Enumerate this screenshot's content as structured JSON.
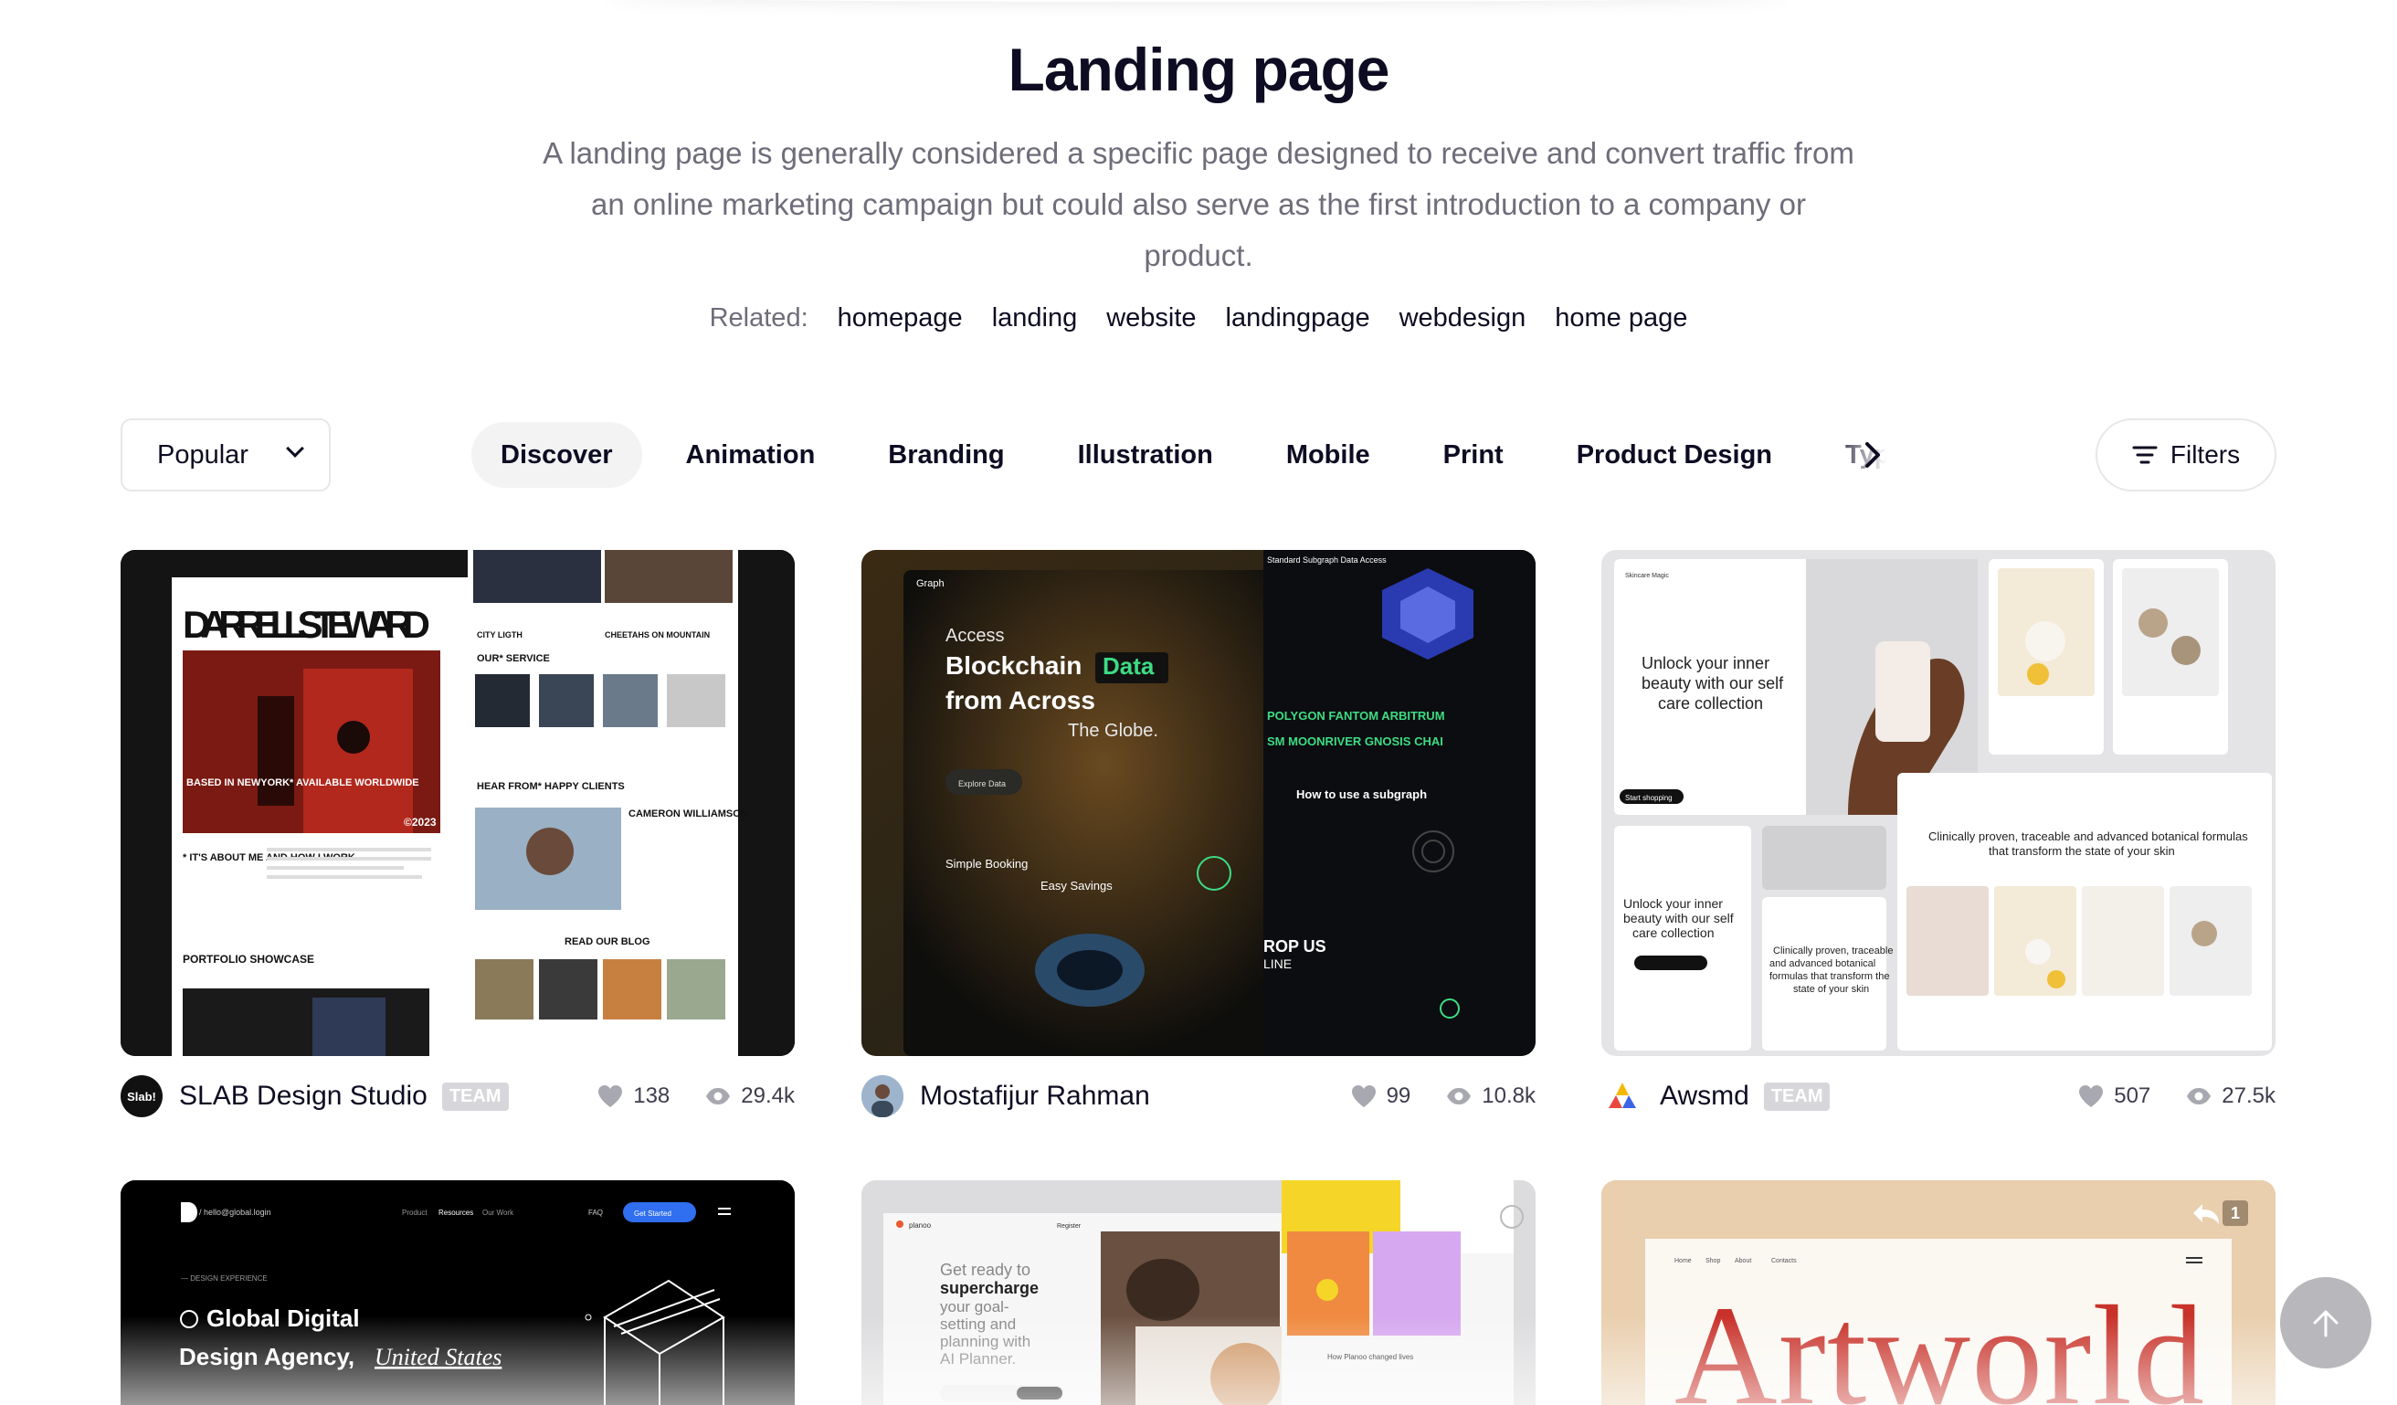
{
  "header": {
    "title": "Landing page",
    "description": "A landing page is generally considered a specific page designed to receive and convert traffic from an online marketing campaign but could also serve as the first introduction to a company or product.",
    "related_label": "Related:",
    "related": [
      "homepage",
      "landing",
      "website",
      "landingpage",
      "webdesign",
      "home page"
    ]
  },
  "toolbar": {
    "sort_value": "Popular",
    "categories": [
      "Discover",
      "Animation",
      "Branding",
      "Illustration",
      "Mobile",
      "Print",
      "Product Design",
      "Typo"
    ],
    "active_category": "Discover",
    "filters_label": "Filters"
  },
  "shots": [
    {
      "author": "SLAB Design Studio",
      "avatar_text": "Slab!",
      "badge": "TEAM",
      "likes": "138",
      "views": "29.4k",
      "thumb": {
        "headline": "DARRELL STEWARD",
        "year": "©2023",
        "tagline": "BASED IN NEWYORK* AVAILABLE WORLDWIDE",
        "about": "* IT'S ABOUT ME AND HOW I WORK",
        "portfolio": "PORTFOLIO SHOWCASE",
        "city": "CITY LIGTH",
        "service": "OUR* SERVICE",
        "hear": "HEAR FROM* HAPPY CLIENTS",
        "person": "CAMERON WILLIAMSON",
        "blog": "READ OUR BLOG",
        "cheetahs": "CHEETAHS ON MOUNTAIN"
      }
    },
    {
      "author": "Mostafijur Rahman",
      "badge": "",
      "likes": "99",
      "views": "10.8k",
      "thumb": {
        "brand": "Graph",
        "access": "Access",
        "line1": "Blockchain",
        "highlight": "Data",
        "line2": "from Across",
        "line3": "The Globe.",
        "cta": "Explore Data",
        "simple": "Simple Booking",
        "easy": "Easy Savings",
        "howto": "How to use a subgraph",
        "standard": "Standard Subgraph Data Access",
        "marquee1": "POLYGON  FANTOM  ARBITRUM",
        "marquee2": "SM  MOONRIVER  GNOSIS CHAI",
        "drop": "ROP US",
        "line": "LINE"
      }
    },
    {
      "author": "Awsmd",
      "badge": "TEAM",
      "likes": "507",
      "views": "27.5k",
      "thumb": {
        "hero": "Unlock your inner beauty with our self care collection",
        "hero_small": "Unlock your inner beauty with our self care collection",
        "clinical": "Clinically proven, traceable and advanced botanical formulas that transform the state of your skin",
        "clinical_small": "Clinically proven, traceable and advanced botanical formulas that transform the state of your skin",
        "cta": "Start shopping",
        "brand": "Skincare Magic"
      }
    }
  ],
  "shots_row2": [
    {
      "email": "/ hello@global.login",
      "nav": [
        "Product",
        "Resources",
        "Our Work"
      ],
      "faq": "FAQ",
      "cta": "Get Started",
      "kicker": "— DESIGN EXPERIENCE",
      "line1": "Global Digital",
      "line2": "Design Agency,",
      "location": "United States"
    },
    {
      "brand": "planoo",
      "heading_light": "Get ready to",
      "heading_bold": "supercharge",
      "heading_rest": "your goal- setting and planning with AI Planner.",
      "changed": "How Planoo changed lives",
      "register": "Register"
    },
    {
      "nav": [
        "Home",
        "Shop",
        "About",
        "Contacts"
      ],
      "headline": "Artworld",
      "count": "1"
    }
  ],
  "colors": {
    "text": "#0d0c22",
    "muted": "#6e6d7a",
    "border": "#e7e7e9",
    "chip_active": "#f3f3f4",
    "badge": "#d7d7db",
    "graph_green": "#3ddc84",
    "art_red": "#c8322a"
  }
}
